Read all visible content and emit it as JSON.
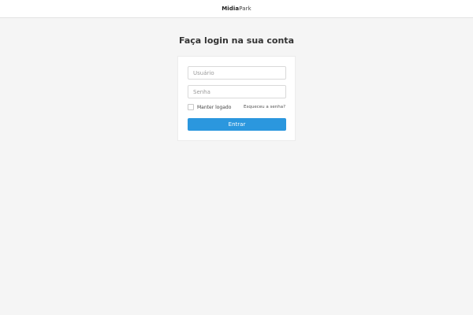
{
  "header": {
    "logo_bold": "Midia",
    "logo_light": "Park"
  },
  "login": {
    "title": "Faça login na sua conta",
    "username_placeholder": "Usuário",
    "username_value": "",
    "password_placeholder": "Senha",
    "password_value": "",
    "remember_label": "Manter logado",
    "remember_checked": false,
    "forgot_label": "Esqueceu a senha?",
    "submit_label": "Entrar"
  },
  "colors": {
    "background": "#f5f5f5",
    "primary_button": "#2b97de"
  }
}
